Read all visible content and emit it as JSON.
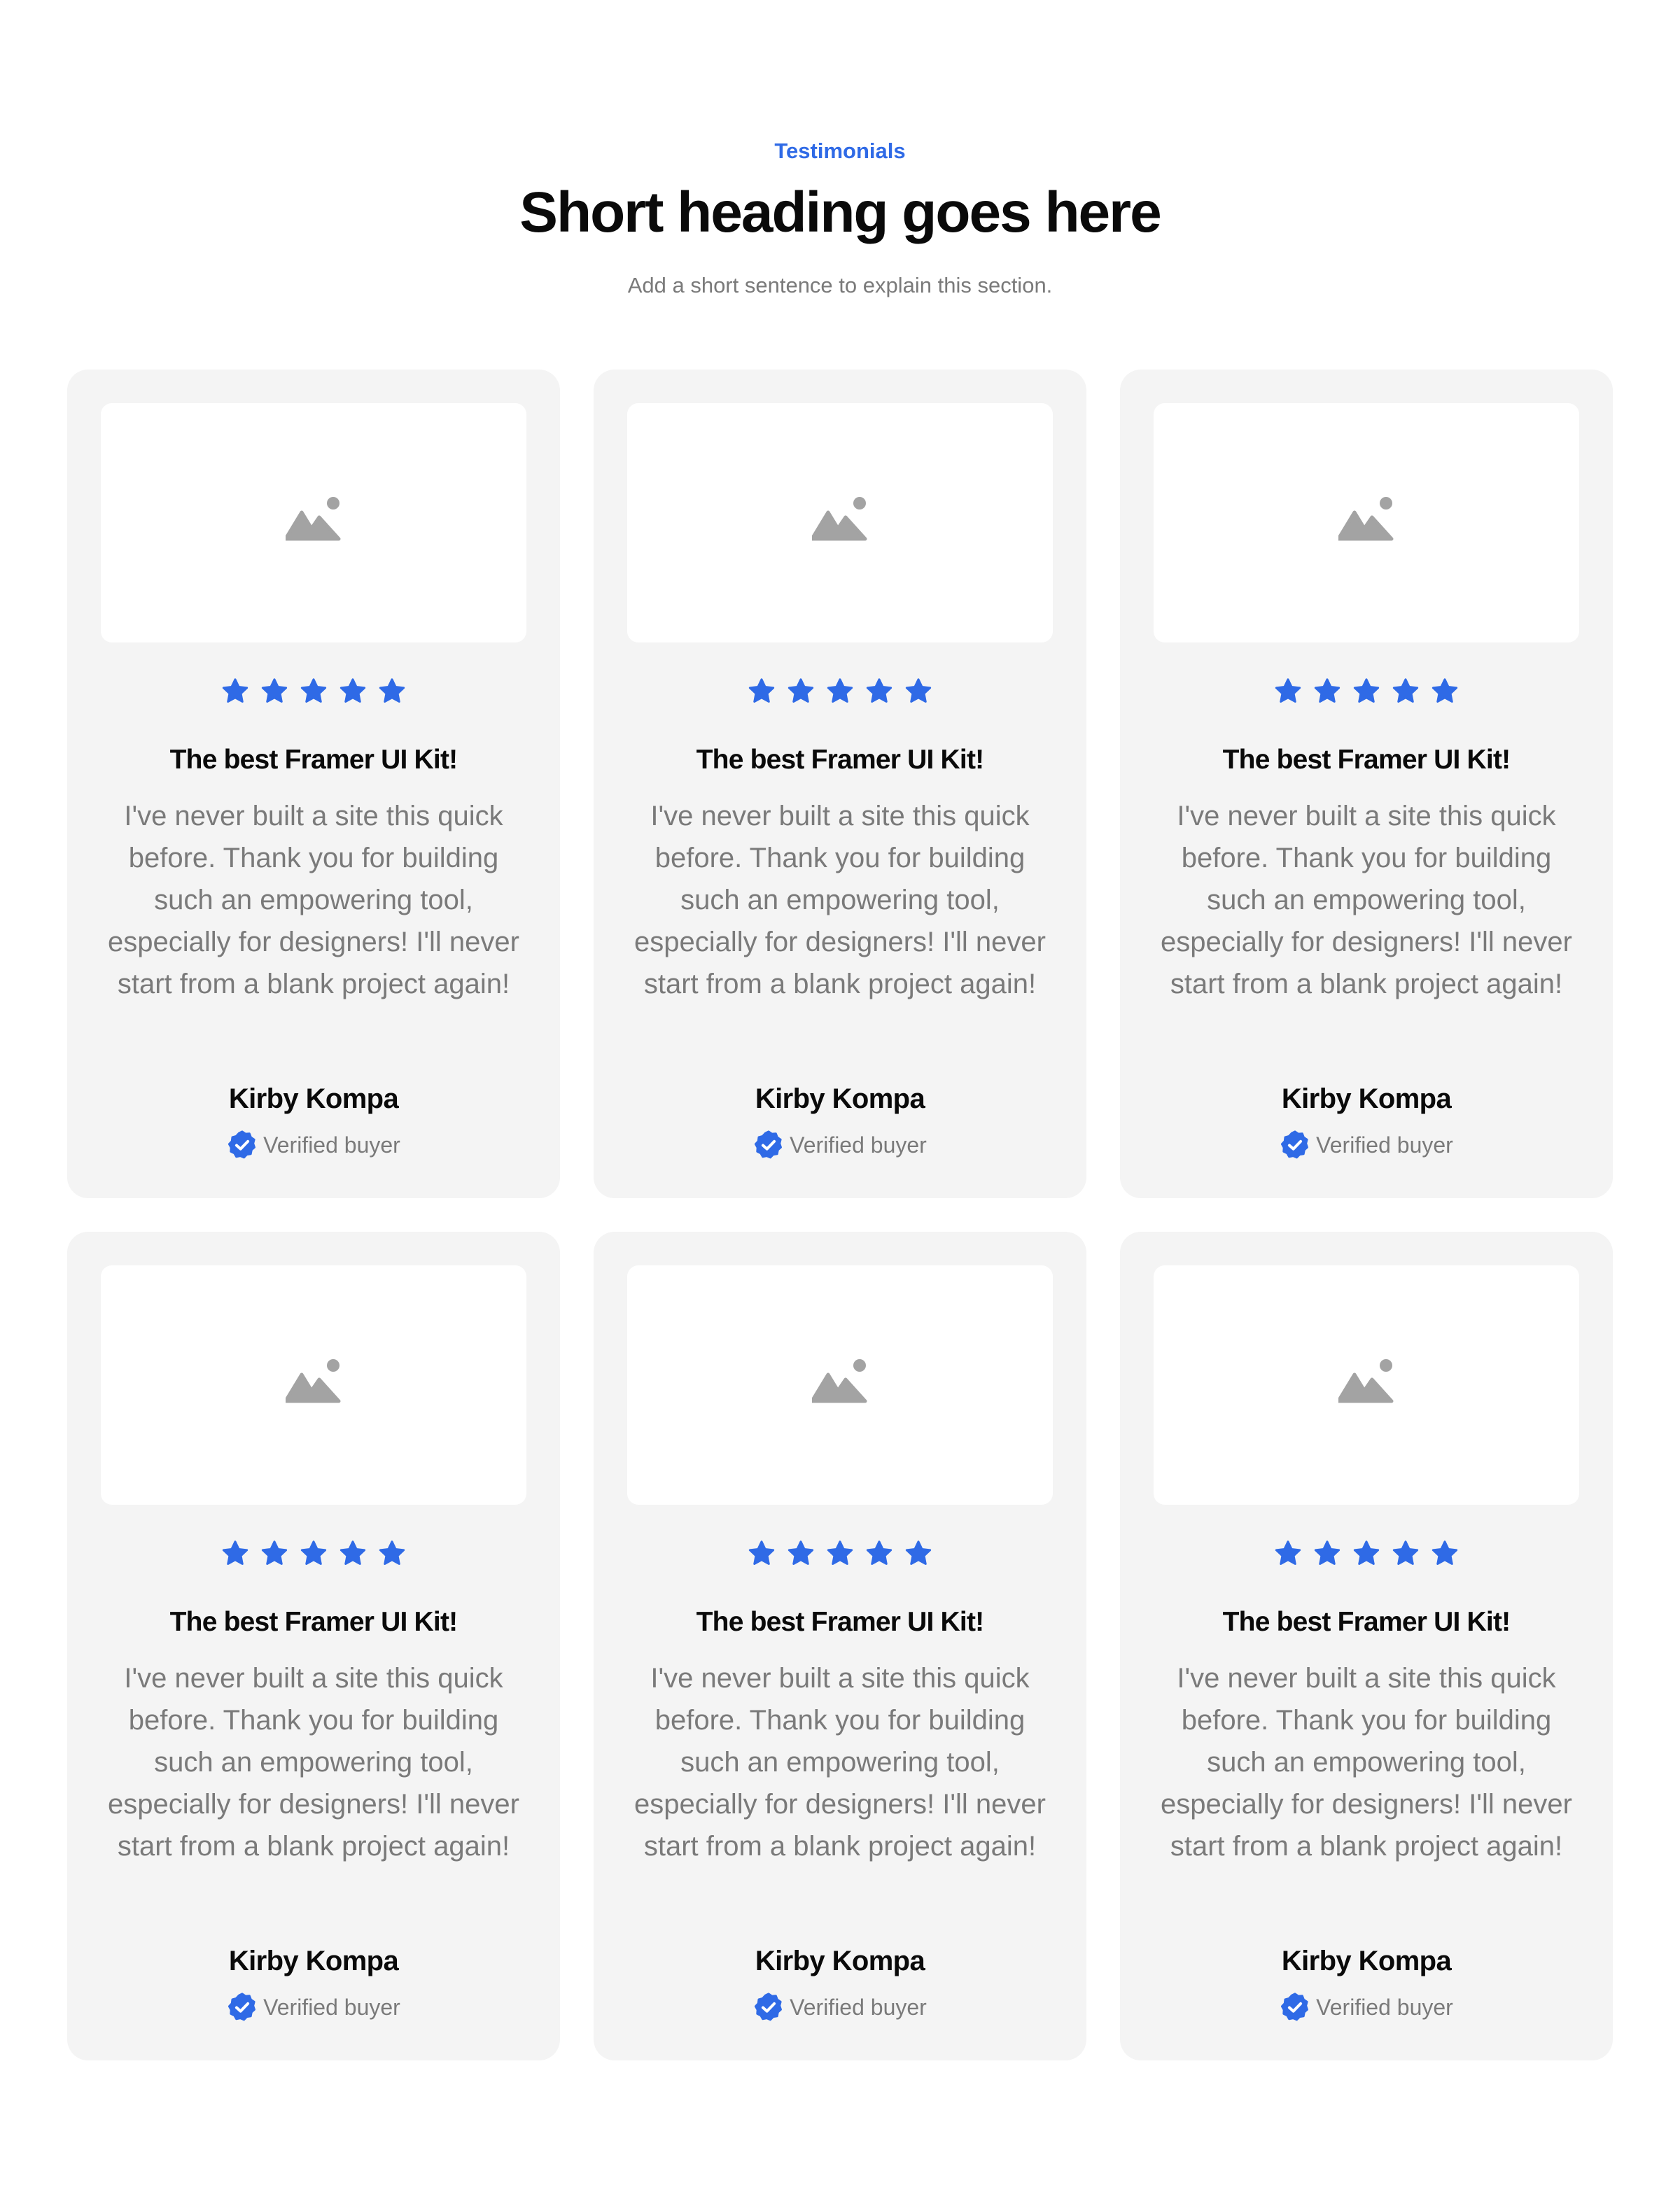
{
  "header": {
    "eyebrow": "Testimonials",
    "heading": "Short heading goes here",
    "subheading": "Add a short sentence to explain this section."
  },
  "colors": {
    "accent": "#2f6ae6",
    "card_background": "#f4f4f4",
    "placeholder_icon": "#a3a3a3",
    "muted_text": "#7a7a7a",
    "heading_text": "#0a0a0a"
  },
  "testimonials": [
    {
      "image_icon": "image-placeholder-icon",
      "rating": 5,
      "rating_max": 5,
      "title": "The best Framer UI Kit!",
      "body": "I've never built a site this quick before. Thank you for building such an empowering tool, especially for designers! I'll never start from a blank project again!",
      "author": "Kirby Kompa",
      "badge_icon": "verified-badge-icon",
      "badge_label": "Verified buyer"
    },
    {
      "image_icon": "image-placeholder-icon",
      "rating": 5,
      "rating_max": 5,
      "title": "The best Framer UI Kit!",
      "body": "I've never built a site this quick before. Thank you for building such an empowering tool, especially for designers! I'll never start from a blank project again!",
      "author": "Kirby Kompa",
      "badge_icon": "verified-badge-icon",
      "badge_label": "Verified buyer"
    },
    {
      "image_icon": "image-placeholder-icon",
      "rating": 5,
      "rating_max": 5,
      "title": "The best Framer UI Kit!",
      "body": "I've never built a site this quick before. Thank you for building such an empowering tool, especially for designers! I'll never start from a blank project again!",
      "author": "Kirby Kompa",
      "badge_icon": "verified-badge-icon",
      "badge_label": "Verified buyer"
    },
    {
      "image_icon": "image-placeholder-icon",
      "rating": 5,
      "rating_max": 5,
      "title": "The best Framer UI Kit!",
      "body": "I've never built a site this quick before. Thank you for building such an empowering tool, especially for designers! I'll never start from a blank project again!",
      "author": "Kirby Kompa",
      "badge_icon": "verified-badge-icon",
      "badge_label": "Verified buyer"
    },
    {
      "image_icon": "image-placeholder-icon",
      "rating": 5,
      "rating_max": 5,
      "title": "The best Framer UI Kit!",
      "body": "I've never built a site this quick before. Thank you for building such an empowering tool, especially for designers! I'll never start from a blank project again!",
      "author": "Kirby Kompa",
      "badge_icon": "verified-badge-icon",
      "badge_label": "Verified buyer"
    },
    {
      "image_icon": "image-placeholder-icon",
      "rating": 5,
      "rating_max": 5,
      "title": "The best Framer UI Kit!",
      "body": "I've never built a site this quick before. Thank you for building such an empowering tool, especially for designers! I'll never start from a blank project again!",
      "author": "Kirby Kompa",
      "badge_icon": "verified-badge-icon",
      "badge_label": "Verified buyer"
    }
  ]
}
